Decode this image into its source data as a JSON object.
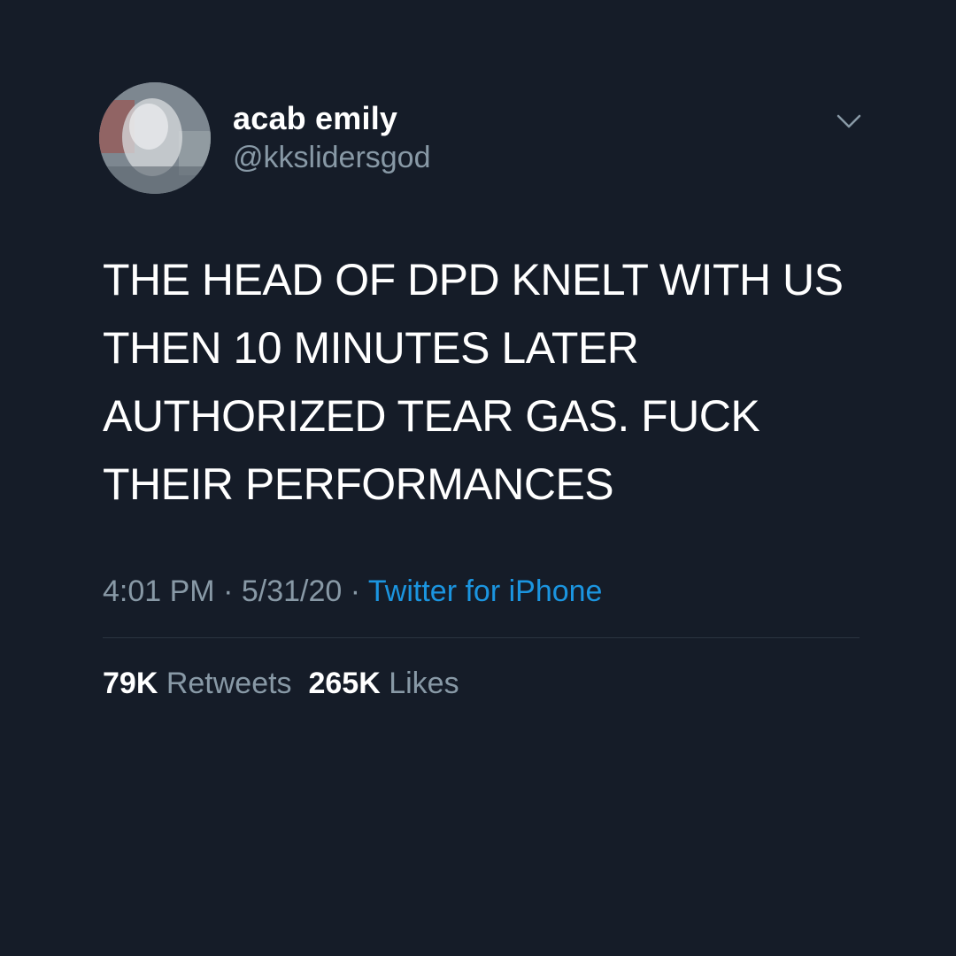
{
  "author": {
    "display_name": "acab emily",
    "handle": "@kkslidersgod"
  },
  "tweet": {
    "text": "THE HEAD OF DPD KNELT WITH US\nTHEN 10 MINUTES LATER\nAUTHORIZED TEAR GAS. FUCK\nTHEIR PERFORMANCES"
  },
  "meta": {
    "time": "4:01 PM",
    "sep1": " · ",
    "date": "5/31/20",
    "sep2": " · ",
    "source": "Twitter for iPhone"
  },
  "stats": {
    "retweets_count": "79K",
    "retweets_label": "Retweets",
    "likes_count": "265K",
    "likes_label": "Likes"
  },
  "icons": {
    "caret": "chevron-down-icon"
  },
  "colors": {
    "background": "#151c28",
    "text_primary": "#ffffff",
    "text_secondary": "#8899a6",
    "link": "#1b95e0",
    "divider": "#2b3440"
  }
}
